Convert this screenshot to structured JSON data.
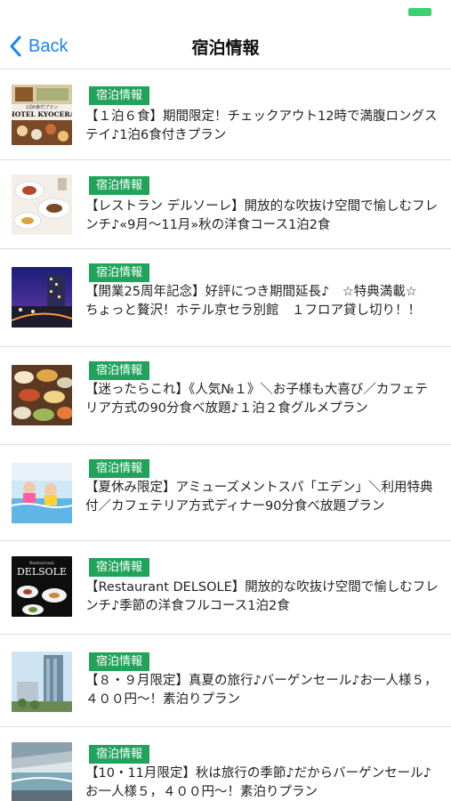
{
  "nav": {
    "back_label": "Back",
    "title": "宿泊情報"
  },
  "items": [
    {
      "badge": "宿泊情報",
      "text": "【１泊６食】期間限定！チェックアウト12時で満腹ロングステイ♪1泊6食付きプラン",
      "thumb_caption": "HOTEL KYOCERA",
      "thumb_subcaption": "1泊6食付プラン"
    },
    {
      "badge": "宿泊情報",
      "text": "【レストラン デルソーレ】開放的な吹抜け空間で愉しむフレンチ♪«9月〜11月»秋の洋食コース1泊2食"
    },
    {
      "badge": "宿泊情報",
      "text": "【開業25周年記念】好評につき期間延長♪　☆特典満載☆　ちょっと贅沢！ホテル京セラ別館　１フロア貸し切り！！"
    },
    {
      "badge": "宿泊情報",
      "text": "【迷ったらこれ】《人気№１》＼お子様も大喜び／カフェテリア方式の90分食べ放題♪１泊２食グルメプラン"
    },
    {
      "badge": "宿泊情報",
      "text": "【夏休み限定】アミューズメントスパ「エデン」＼利用特典付／カフェテリア方式ディナー90分食べ放題プラン"
    },
    {
      "badge": "宿泊情報",
      "text": "【Restaurant DELSOLE】開放的な吹抜け空間で愉しむフレンチ♪季節の洋食フルコース1泊2食",
      "thumb_caption": "DELSOLE",
      "thumb_subcaption": "Restaurant"
    },
    {
      "badge": "宿泊情報",
      "text": "【８・９月限定】真夏の旅行♪バーゲンセール♪お一人様５，４００円〜！素泊りプラン"
    },
    {
      "badge": "宿泊情報",
      "text": "【10・11月限定】秋は旅行の季節♪だからバーゲンセール♪お一人様５，４００円〜！素泊りプラン"
    }
  ],
  "colors": {
    "accent": "#1a84f3",
    "badge": "#21a35b",
    "battery": "#3cd070"
  }
}
